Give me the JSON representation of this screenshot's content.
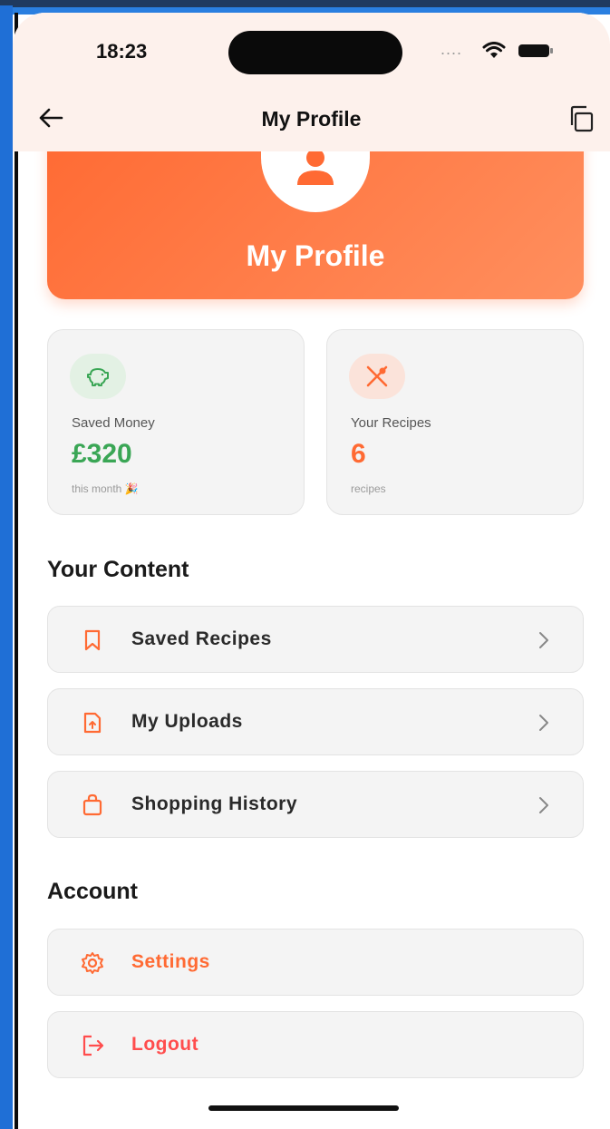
{
  "status_bar": {
    "time": "18:23",
    "signal_dots": "....",
    "icons": [
      "wifi-icon",
      "battery-icon"
    ]
  },
  "header": {
    "title": "My Profile",
    "back_icon": "arrow-left-icon",
    "action_icon": "copy-icon"
  },
  "banner": {
    "title": "My Profile",
    "avatar_icon": "user-icon",
    "gradient": [
      "#ff6a33",
      "#ff8f5e"
    ]
  },
  "stats": [
    {
      "label": "Saved Money",
      "value": "£320",
      "sub": "this month 🎉",
      "icon": "piggy-bank-icon",
      "color": "#3aa655",
      "icon_bg": "#e3f1e4"
    },
    {
      "label": "Your Recipes",
      "value": "6",
      "sub": "recipes",
      "icon": "utensils-icon",
      "color": "#ff6a33",
      "icon_bg": "#fbe3da"
    }
  ],
  "sections": {
    "content_title": "Your Content",
    "account_title": "Account"
  },
  "content_items": [
    {
      "label": "Saved Recipes",
      "icon": "bookmark-icon"
    },
    {
      "label": "My Uploads",
      "icon": "file-upload-icon"
    },
    {
      "label": "Shopping History",
      "icon": "shopping-bag-icon"
    }
  ],
  "account_items": [
    {
      "label": "Settings",
      "icon": "gear-icon"
    },
    {
      "label": "Logout",
      "icon": "logout-icon"
    }
  ],
  "colors": {
    "accent": "#ff6a33",
    "header_bg": "#fdf1ec",
    "card_bg": "#f4f4f4",
    "money_green": "#3aa655"
  }
}
